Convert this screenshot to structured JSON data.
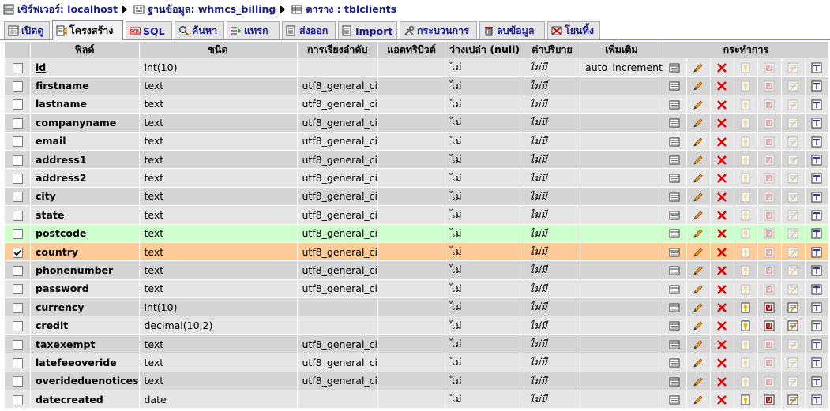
{
  "breadcrumb": [
    {
      "label": "เซิร์ฟเวอร์: localhost",
      "icon": "server-icon"
    },
    {
      "label": "ฐานข้อมูล: whmcs_billing",
      "icon": "database-icon"
    },
    {
      "label": "ตาราง : tblclients",
      "icon": "table-icon"
    }
  ],
  "tabs": [
    {
      "label": "เปิดดู",
      "icon": "browse-icon"
    },
    {
      "label": "โครงสร้าง",
      "icon": "structure-icon",
      "active": true
    },
    {
      "label": "SQL",
      "icon": "sql-icon"
    },
    {
      "label": "ค้นหา",
      "icon": "search-icon"
    },
    {
      "label": "แทรก",
      "icon": "insert-icon"
    },
    {
      "label": "ส่งออก",
      "icon": "export-icon"
    },
    {
      "label": "Import",
      "icon": "import-icon"
    },
    {
      "label": "กระบวนการ",
      "icon": "operations-icon"
    },
    {
      "label": "ลบข้อมูล",
      "icon": "empty-icon"
    },
    {
      "label": "โยนทิ้ง",
      "icon": "drop-icon"
    }
  ],
  "columns": [
    "ฟิลด์",
    "ชนิด",
    "การเรียงลำดับ",
    "แอตทริบิวต์",
    "ว่างเปล่า (null)",
    "ค่าปริยาย",
    "เพิ่มเติม",
    "กระทำการ"
  ],
  "action_icons": [
    "browse-distinct-icon",
    "edit-icon",
    "delete-icon",
    "primary-key-icon",
    "unique-icon",
    "index-icon",
    "fulltext-icon"
  ],
  "rows": [
    {
      "field": "id",
      "type": "int(10)",
      "collation": "",
      "attributes": "",
      "null": "ไม่",
      "default": "ไม่มี",
      "extra": "auto_increment",
      "pk": true
    },
    {
      "field": "firstname",
      "type": "text",
      "collation": "utf8_general_ci",
      "attributes": "",
      "null": "ไม่",
      "default": "ไม่มี",
      "extra": ""
    },
    {
      "field": "lastname",
      "type": "text",
      "collation": "utf8_general_ci",
      "attributes": "",
      "null": "ไม่",
      "default": "ไม่มี",
      "extra": ""
    },
    {
      "field": "companyname",
      "type": "text",
      "collation": "utf8_general_ci",
      "attributes": "",
      "null": "ไม่",
      "default": "ไม่มี",
      "extra": ""
    },
    {
      "field": "email",
      "type": "text",
      "collation": "utf8_general_ci",
      "attributes": "",
      "null": "ไม่",
      "default": "ไม่มี",
      "extra": ""
    },
    {
      "field": "address1",
      "type": "text",
      "collation": "utf8_general_ci",
      "attributes": "",
      "null": "ไม่",
      "default": "ไม่มี",
      "extra": ""
    },
    {
      "field": "address2",
      "type": "text",
      "collation": "utf8_general_ci",
      "attributes": "",
      "null": "ไม่",
      "default": "ไม่มี",
      "extra": ""
    },
    {
      "field": "city",
      "type": "text",
      "collation": "utf8_general_ci",
      "attributes": "",
      "null": "ไม่",
      "default": "ไม่มี",
      "extra": ""
    },
    {
      "field": "state",
      "type": "text",
      "collation": "utf8_general_ci",
      "attributes": "",
      "null": "ไม่",
      "default": "ไม่มี",
      "extra": ""
    },
    {
      "field": "postcode",
      "type": "text",
      "collation": "utf8_general_ci",
      "attributes": "",
      "null": "ไม่",
      "default": "ไม่มี",
      "extra": "",
      "state": "hover"
    },
    {
      "field": "country",
      "type": "text",
      "collation": "utf8_general_ci",
      "attributes": "",
      "null": "ไม่",
      "default": "ไม่มี",
      "extra": "",
      "state": "marked",
      "checked": true
    },
    {
      "field": "phonenumber",
      "type": "text",
      "collation": "utf8_general_ci",
      "attributes": "",
      "null": "ไม่",
      "default": "ไม่มี",
      "extra": ""
    },
    {
      "field": "password",
      "type": "text",
      "collation": "utf8_general_ci",
      "attributes": "",
      "null": "ไม่",
      "default": "ไม่มี",
      "extra": ""
    },
    {
      "field": "currency",
      "type": "int(10)",
      "collation": "",
      "attributes": "",
      "null": "ไม่",
      "default": "ไม่มี",
      "extra": "",
      "index_enabled": true
    },
    {
      "field": "credit",
      "type": "decimal(10,2)",
      "collation": "",
      "attributes": "",
      "null": "ไม่",
      "default": "ไม่มี",
      "extra": "",
      "index_enabled": true
    },
    {
      "field": "taxexempt",
      "type": "text",
      "collation": "utf8_general_ci",
      "attributes": "",
      "null": "ไม่",
      "default": "ไม่มี",
      "extra": ""
    },
    {
      "field": "latefeeoveride",
      "type": "text",
      "collation": "utf8_general_ci",
      "attributes": "",
      "null": "ไม่",
      "default": "ไม่มี",
      "extra": ""
    },
    {
      "field": "overideduenotices",
      "type": "text",
      "collation": "utf8_general_ci",
      "attributes": "",
      "null": "ไม่",
      "default": "ไม่มี",
      "extra": ""
    },
    {
      "field": "datecreated",
      "type": "date",
      "collation": "",
      "attributes": "",
      "null": "ไม่",
      "default": "ไม่มี",
      "extra": "",
      "index_enabled": true
    }
  ]
}
